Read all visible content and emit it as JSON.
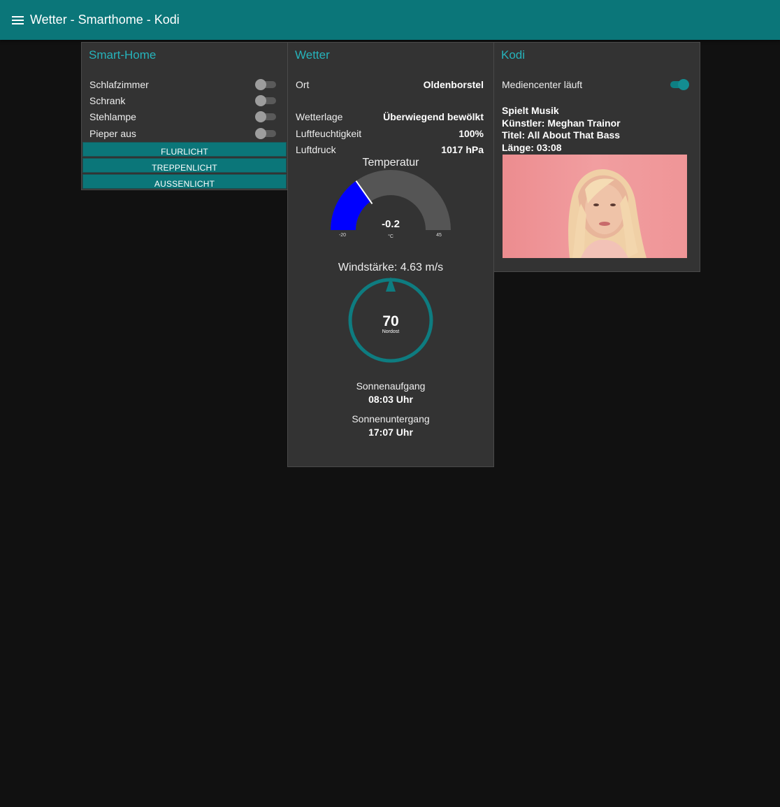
{
  "header": {
    "title": "Wetter - Smarthome - Kodi"
  },
  "smarthome": {
    "title": "Smart-Home",
    "switches": [
      {
        "label": "Schlafzimmer",
        "on": false
      },
      {
        "label": "Schrank",
        "on": false
      },
      {
        "label": "Stehlampe",
        "on": false
      },
      {
        "label": "Pieper aus",
        "on": false
      }
    ],
    "buttons": [
      "FLURLICHT",
      "TREPPENLICHT",
      "AUSSENLICHT"
    ]
  },
  "weather": {
    "title": "Wetter",
    "ort_label": "Ort",
    "ort_value": "Oldenborstel",
    "wetterlage_label": "Wetterlage",
    "wetterlage_value": "Überwiegend bewölkt",
    "humidity_label": "Luftfeuchtigkeit",
    "humidity_value": "100%",
    "pressure_label": "Luftdruck",
    "pressure_value": "1017 hPa",
    "temp_gauge": {
      "title": "Temperatur",
      "value": -0.2,
      "value_label": "-0.2",
      "unit": "°C",
      "min": -20,
      "max": 45,
      "min_label": "-20",
      "max_label": "45",
      "fill_color": "#0000ff",
      "track_color": "#555555"
    },
    "wind": {
      "title": "Windstärke: 4.63 m/s",
      "direction_deg": 70,
      "direction_label": "70",
      "direction_name": "Nordost",
      "ring_color": "#0e7c80"
    },
    "sunrise_label": "Sonnenaufgang",
    "sunrise_value": "08:03 Uhr",
    "sunset_label": "Sonnenuntergang",
    "sunset_value": "17:07 Uhr"
  },
  "kodi": {
    "title": "Kodi",
    "mediacenter_label": "Mediencenter läuft",
    "mediacenter_on": true,
    "status": "Spielt Musik",
    "artist": "Künstler: Meghan Trainor",
    "track_title": "Titel: All About That Bass",
    "length": "Länge: 03:08"
  }
}
